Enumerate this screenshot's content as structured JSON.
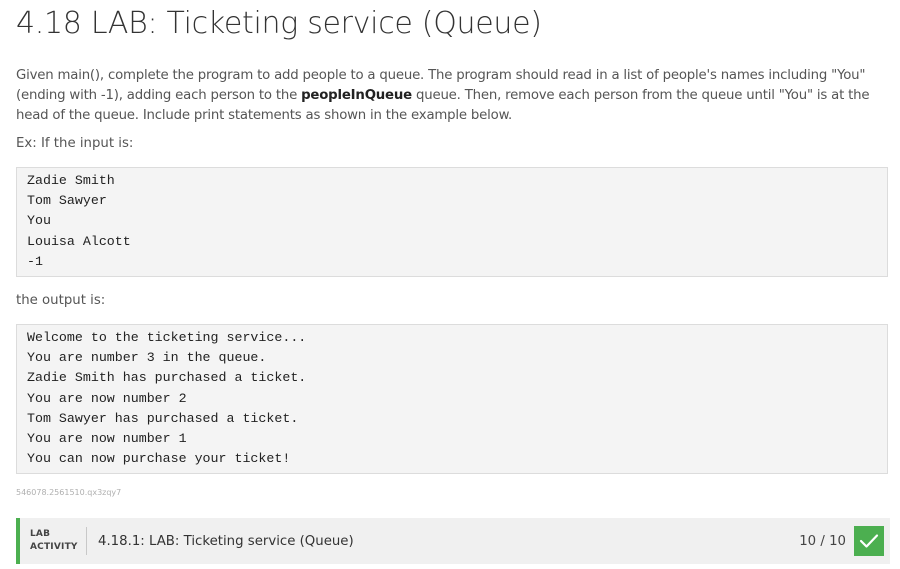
{
  "title": "4.18 LAB: Ticketing service (Queue)",
  "description": {
    "before": "Given main(), complete the program to add people to a queue. The program should read in a list of people's names including \"You\" (ending with -1), adding each person to the ",
    "bold": "peopleInQueue",
    "after": " queue. Then, remove each person from the queue until \"You\" is at the head of the queue. Include print statements as shown in the example below."
  },
  "example_label": "Ex: If the input is:",
  "input_lines": [
    "Zadie Smith",
    "Tom Sawyer",
    "You",
    "Louisa Alcott",
    "-1"
  ],
  "output_label": "the output is:",
  "output_lines": [
    "Welcome to the ticketing service...",
    "You are number 3 in the queue.",
    "Zadie Smith has purchased a ticket.",
    "You are now number 2",
    "Tom Sawyer has purchased a ticket.",
    "You are now number 1",
    "You can now purchase your ticket!"
  ],
  "activity_id": "546078.2561510.qx3zqy7",
  "lab_activity": {
    "tag_line1": "LAB",
    "tag_line2": "ACTIVITY",
    "name": "4.18.1: LAB: Ticketing service (Queue)",
    "score": "10 / 10",
    "check_icon": "checkmark-icon"
  },
  "colors": {
    "accent_green": "#4caf50",
    "code_background": "#f4f4f4"
  }
}
